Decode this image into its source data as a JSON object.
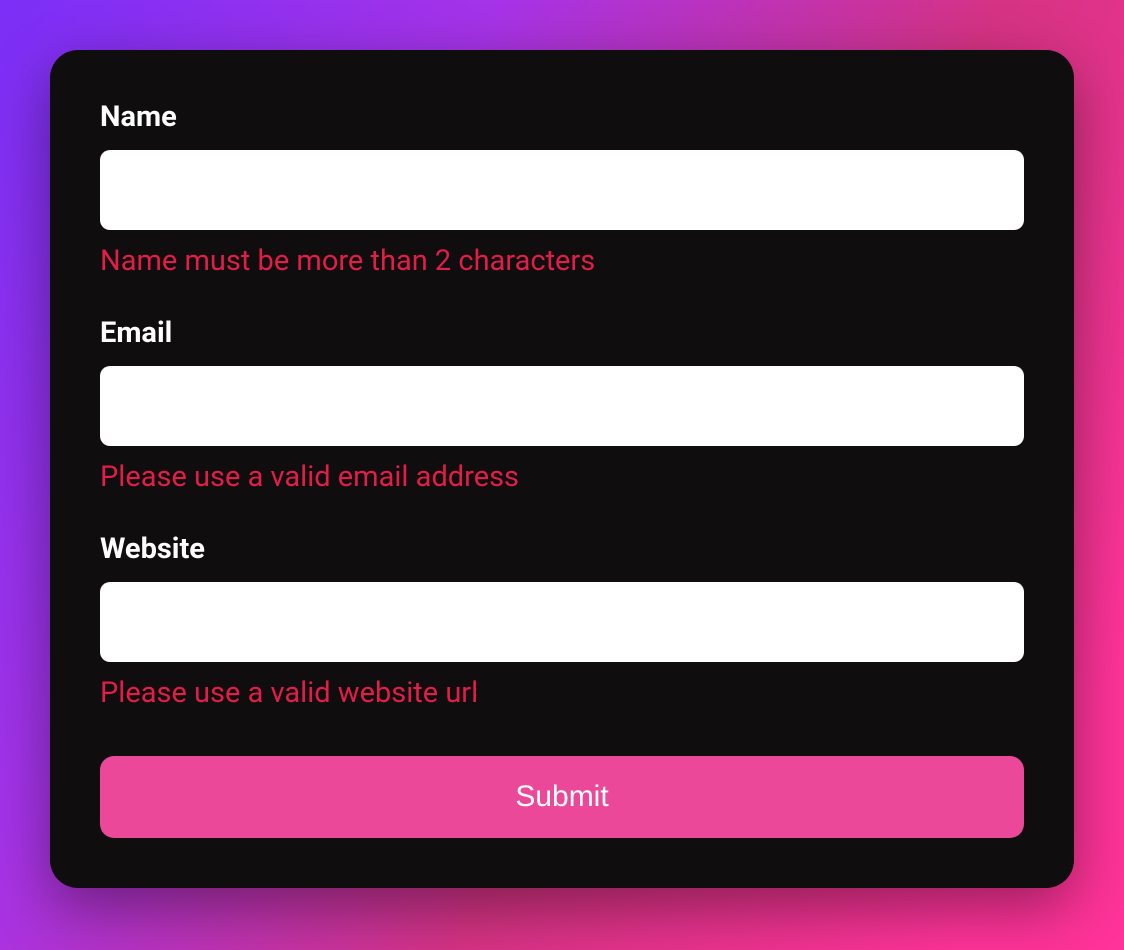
{
  "form": {
    "fields": {
      "name": {
        "label": "Name",
        "value": "",
        "error": "Name must be more than 2 characters"
      },
      "email": {
        "label": "Email",
        "value": "",
        "error": "Please use a valid email address"
      },
      "website": {
        "label": "Website",
        "value": "",
        "error": "Please use a valid website url"
      }
    },
    "submit_label": "Submit"
  },
  "colors": {
    "card_bg": "#0f0d0e",
    "error": "#e11d48",
    "button": "#ec4899",
    "text": "#ffffff"
  }
}
